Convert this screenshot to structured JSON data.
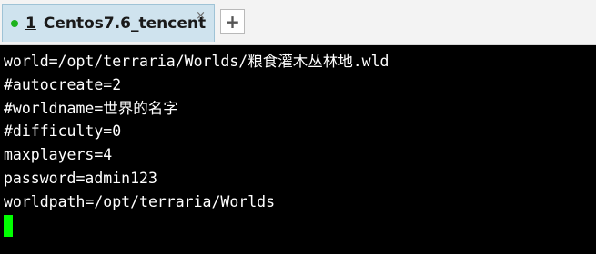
{
  "tab": {
    "number": "1",
    "title": "Centos7.6_tencent",
    "close_glyph": "×",
    "status_color": "#1db31d"
  },
  "toolbar": {
    "new_tab_label": "+"
  },
  "terminal": {
    "lines": [
      "world=/opt/terraria/Worlds/粮食灌木丛林地.wld",
      "#autocreate=2",
      "#worldname=世界的名字",
      "#difficulty=0",
      "maxplayers=4",
      "password=admin123",
      "worldpath=/opt/terraria/Worlds"
    ],
    "cursor_color": "#00ff00",
    "background": "#000000",
    "foreground": "#ffffff"
  }
}
